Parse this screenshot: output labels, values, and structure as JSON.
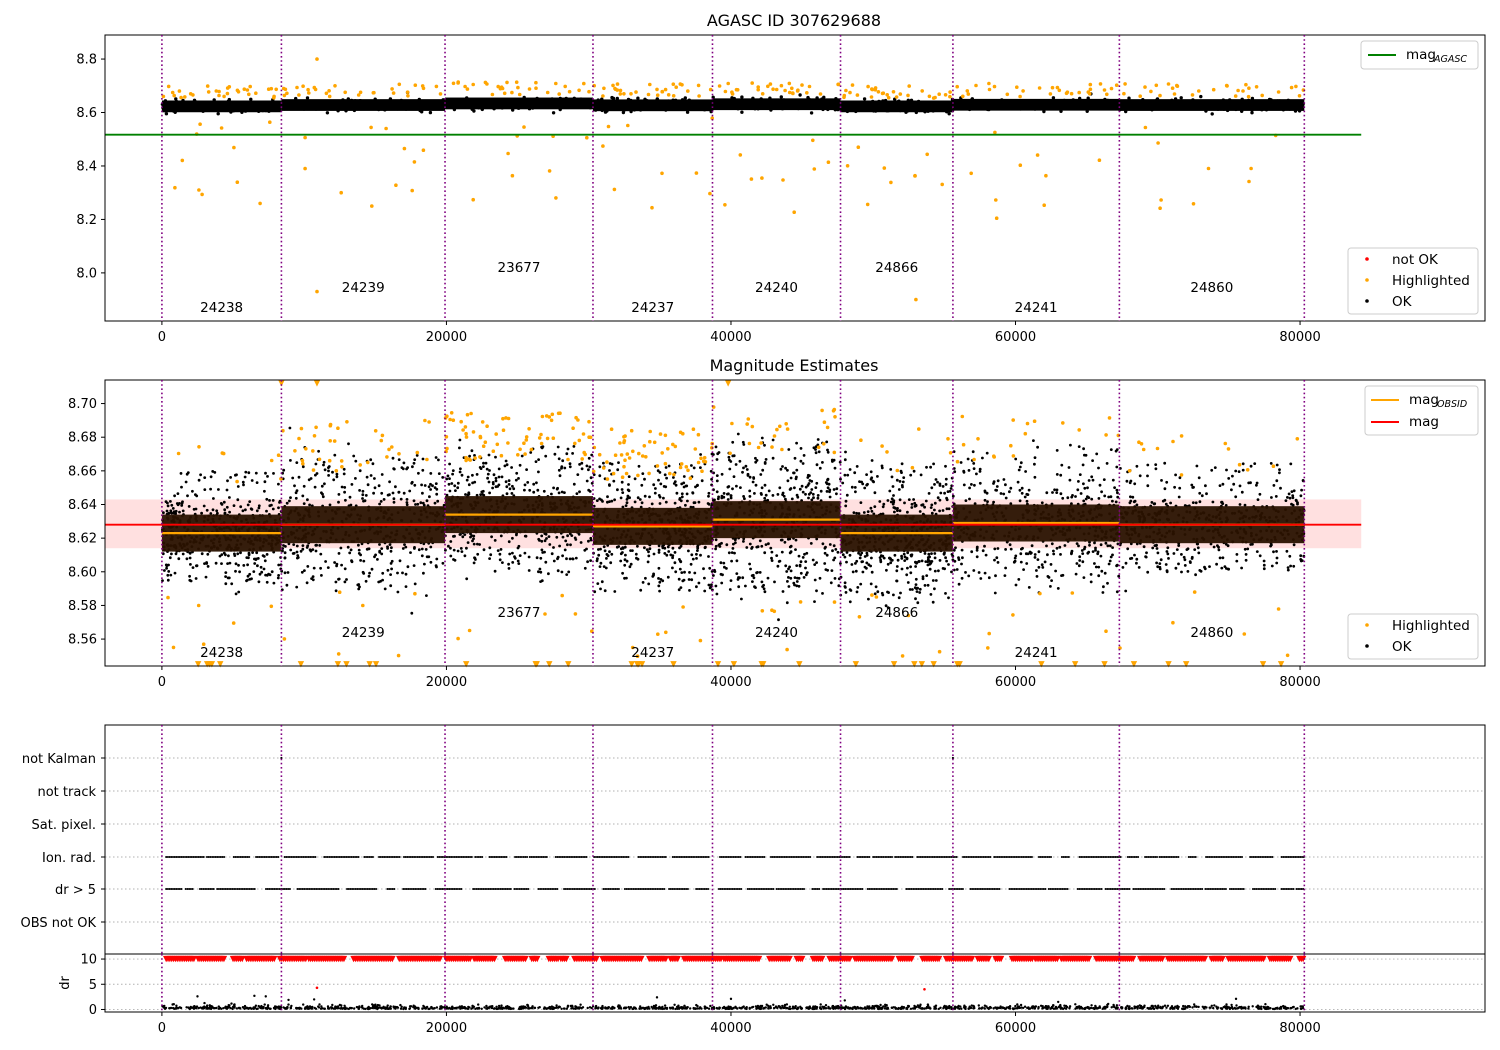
{
  "chart_data": [
    {
      "type": "scatter",
      "title": "AGASC ID 307629688",
      "xlim": [
        -4000,
        93000
      ],
      "ylim": [
        7.82,
        8.89
      ],
      "xticks": [
        0,
        20000,
        40000,
        60000,
        80000
      ],
      "xticklabels": [
        "0",
        "20000",
        "40000",
        "60000",
        "80000"
      ],
      "yticks": [
        8.0,
        8.2,
        8.4,
        8.6,
        8.8
      ],
      "yticklabels": [
        "8.0",
        "8.2",
        "8.4",
        "8.6",
        "8.8"
      ],
      "mag_agasc": 8.517,
      "mag_agasc_x_range": [
        -4000,
        84300
      ],
      "obs_boundaries": [
        0,
        8400,
        19900,
        30300,
        38700,
        47700,
        55600,
        67300,
        80300
      ],
      "observations": [
        {
          "obsid": "24238",
          "x_start": 0,
          "x_end": 8400,
          "mag": 8.623,
          "ok_low": 8.605,
          "ok_high": 8.645
        },
        {
          "obsid": "24239",
          "x_start": 8400,
          "x_end": 19900,
          "mag": 8.628,
          "ok_low": 8.6,
          "ok_high": 8.655
        },
        {
          "obsid": "23677",
          "x_start": 19900,
          "x_end": 30300,
          "mag": 8.634,
          "ok_low": 8.61,
          "ok_high": 8.66
        },
        {
          "obsid": "24237",
          "x_start": 30300,
          "x_end": 38700,
          "mag": 8.627,
          "ok_low": 8.6,
          "ok_high": 8.65
        },
        {
          "obsid": "24240",
          "x_start": 38700,
          "x_end": 47700,
          "mag": 8.631,
          "ok_low": 8.6,
          "ok_high": 8.665
        },
        {
          "obsid": "24866",
          "x_start": 47700,
          "x_end": 55600,
          "mag": 8.623,
          "ok_low": 8.595,
          "ok_high": 8.65
        },
        {
          "obsid": "24241",
          "x_start": 55600,
          "x_end": 67300,
          "mag": 8.629,
          "ok_low": 8.605,
          "ok_high": 8.66
        },
        {
          "obsid": "24860",
          "x_start": 67300,
          "x_end": 80300,
          "mag": 8.628,
          "ok_low": 8.61,
          "ok_high": 8.65
        }
      ],
      "legend_lines": [
        {
          "label": "mag",
          "subscript": "AGASC",
          "color": "#008000"
        }
      ],
      "legend_points": [
        {
          "label": "not OK",
          "color": "#ff0000"
        },
        {
          "label": "Highlighted",
          "color": "#ffa500"
        },
        {
          "label": "OK",
          "color": "#000000"
        }
      ]
    },
    {
      "type": "scatter",
      "title": "Magnitude Estimates",
      "xlim": [
        -4000,
        93000
      ],
      "ylim": [
        8.544,
        8.714
      ],
      "xticks": [
        0,
        20000,
        40000,
        60000,
        80000
      ],
      "xticklabels": [
        "0",
        "20000",
        "40000",
        "60000",
        "80000"
      ],
      "yticks": [
        8.56,
        8.58,
        8.6,
        8.62,
        8.64,
        8.66,
        8.68,
        8.7
      ],
      "yticklabels": [
        "8.56",
        "8.58",
        "8.60",
        "8.62",
        "8.64",
        "8.66",
        "8.68",
        "8.70"
      ],
      "mag": 8.628,
      "mag_band": [
        8.614,
        8.643
      ],
      "mag_x_range": [
        -4000,
        84300
      ],
      "legend_lines": [
        {
          "label": "mag",
          "subscript": "OBSID",
          "color": "#ffa500"
        },
        {
          "label": "mag",
          "subscript": "",
          "color": "#ff0000"
        }
      ],
      "legend_points": [
        {
          "label": "Highlighted",
          "color": "#ffa500"
        },
        {
          "label": "OK",
          "color": "#000000"
        }
      ]
    },
    {
      "type": "scatter",
      "title": "",
      "xlim": [
        -4000,
        93000
      ],
      "flag_rows": [
        "not Kalman",
        "not track",
        "Sat. pixel.",
        "Ion. rad.",
        "dr > 5",
        "OBS not OK"
      ],
      "flagged_rows": [
        "Ion. rad.",
        "dr > 5"
      ]
    },
    {
      "type": "scatter",
      "title": "",
      "ylabel": "dr",
      "xlim": [
        -4000,
        93000
      ],
      "ylim": [
        -0.5,
        11
      ],
      "xticks": [
        0,
        20000,
        40000,
        60000,
        80000
      ],
      "xticklabels": [
        "0",
        "20000",
        "40000",
        "60000",
        "80000"
      ],
      "yticks": [
        0,
        5,
        10
      ],
      "yticklabels": [
        "0",
        "5",
        "10"
      ],
      "clipped_marker_value": 10
    }
  ]
}
